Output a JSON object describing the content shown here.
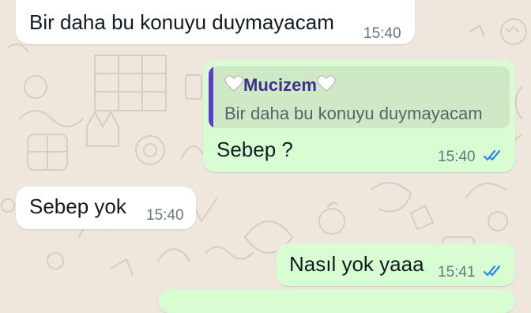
{
  "colors": {
    "chat_background": "#efe7de",
    "incoming_bubble": "#ffffff",
    "outgoing_bubble": "#d9fdd3",
    "quote_accent": "#5d3ec9",
    "read_ticks": "#53bdeb"
  },
  "messages": [
    {
      "direction": "incoming",
      "text": "Bir daha bu konuyu duymayacam",
      "time": "15:40"
    },
    {
      "direction": "outgoing",
      "quoted": {
        "author": "Mucizem",
        "author_icon": "white-heart-icon",
        "text": "Bir daha bu konuyu duymayacam"
      },
      "text": "Sebep ?",
      "time": "15:40",
      "status_icon": "double-check-read-icon"
    },
    {
      "direction": "incoming",
      "text": "Sebep yok",
      "time": "15:40"
    },
    {
      "direction": "outgoing",
      "text": "Nasıl yok yaaa",
      "time": "15:41",
      "status_icon": "double-check-read-icon"
    }
  ]
}
